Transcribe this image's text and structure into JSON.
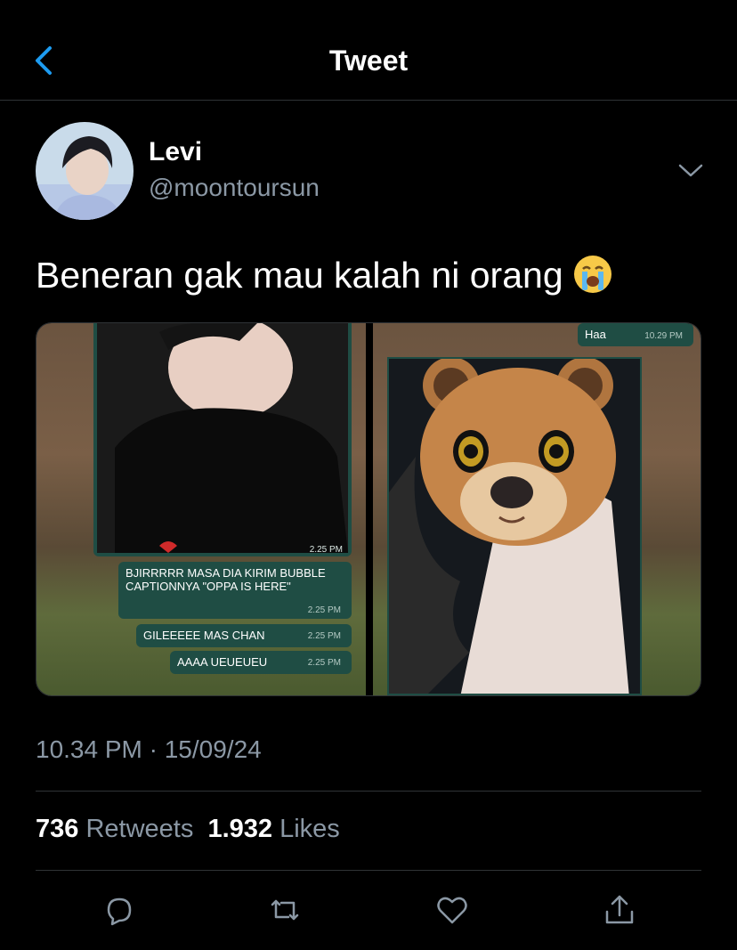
{
  "header": {
    "title": "Tweet",
    "back_icon": "chevron-left-icon"
  },
  "author": {
    "name": "Levi",
    "handle": "@moontoursun"
  },
  "tweet": {
    "text": "Beneran gak mau kalah ni orang",
    "emoji": "loudly-crying-face-emoji",
    "timestamp": "10.34 PM · 15/09/24"
  },
  "media": {
    "left": {
      "photo_time": "2.25 PM",
      "messages": [
        {
          "line1": "BJIRRRRR MASA DIA KIRIM BUBBLE",
          "line2": "CAPTIONNYA \"OPPA IS HERE\"",
          "time": "2.25 PM"
        },
        {
          "text": "GILEEEEE MAS CHAN",
          "time": "2.25 PM"
        },
        {
          "text": "AAAA UEUEUEU",
          "time": "2.25 PM"
        }
      ]
    },
    "right": {
      "message": "Haa",
      "time": "10.29 PM"
    }
  },
  "stats": {
    "retweets_count": "736",
    "retweets_label": "Retweets",
    "likes_count": "1.932",
    "likes_label": "Likes"
  },
  "actions": [
    "reply-icon",
    "retweet-icon",
    "like-icon",
    "share-icon"
  ],
  "colors": {
    "accent": "#1d9bf0",
    "secondary_text": "#8b98a5",
    "divider": "#2f3336",
    "chat_bubble": "#1f4d44"
  }
}
